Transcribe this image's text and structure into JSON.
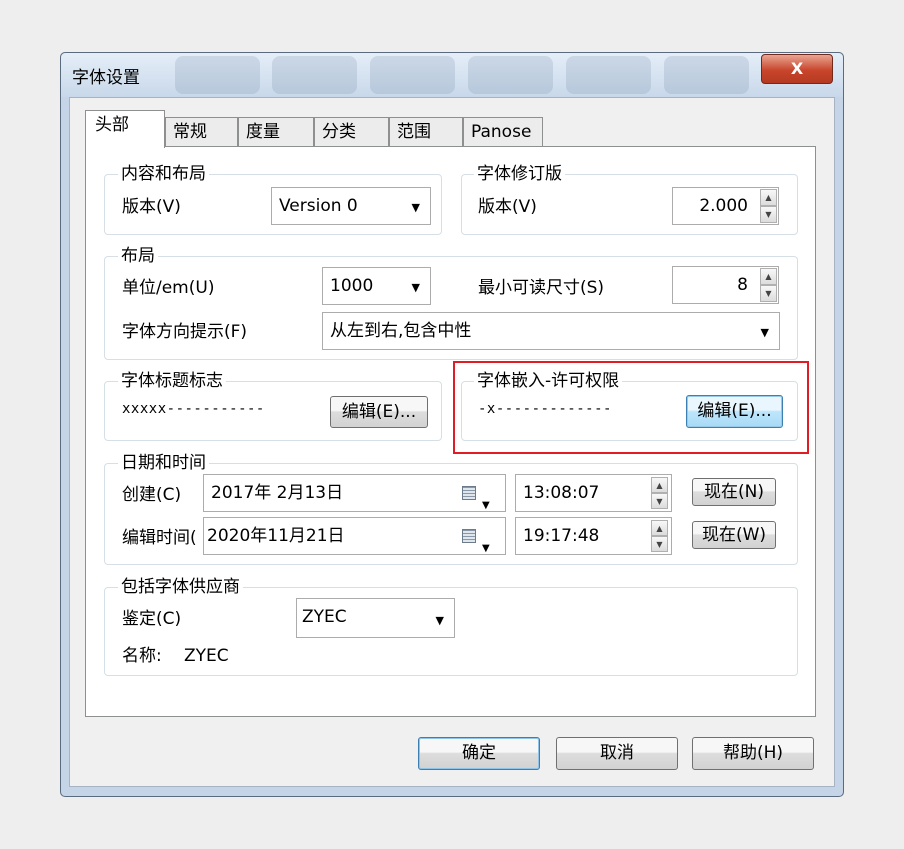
{
  "window": {
    "title": "字体设置",
    "close_label": "X"
  },
  "tabs": [
    {
      "label": "头部",
      "active": true
    },
    {
      "label": "常规"
    },
    {
      "label": "度量"
    },
    {
      "label": "分类"
    },
    {
      "label": "范围"
    },
    {
      "label": "Panose"
    }
  ],
  "content_layout": {
    "legend": "内容和布局",
    "version_label": "版本(V)",
    "version_value": "Version 0"
  },
  "font_revision": {
    "legend": "字体修订版",
    "version_label": "版本(V)",
    "version_value": "2.000"
  },
  "layout": {
    "legend": "布局",
    "units_label": "单位/em(U)",
    "units_value": "1000",
    "min_size_label": "最小可读尺寸(S)",
    "min_size_value": "8",
    "direction_label": "字体方向提示(F)",
    "direction_value": "从左到右,包含中性"
  },
  "style_flags": {
    "legend": "字体标题标志",
    "value": "xxxxx-----------",
    "edit_label": "编辑(E)..."
  },
  "embedding": {
    "legend": "字体嵌入-许可权限",
    "value": "-x-------------",
    "edit_label": "编辑(E)..."
  },
  "datetime": {
    "legend": "日期和时间",
    "created_label": "创建(C)",
    "created_date": "2017年  2月13日",
    "created_time": "13:08:07",
    "now_n_label": "现在(N)",
    "modified_label": "编辑时间(",
    "modified_date": "2020年11月21日",
    "modified_time": "19:17:48",
    "now_w_label": "现在(W)"
  },
  "vendor": {
    "legend": "包括字体供应商",
    "id_label": "鉴定(C)",
    "id_value": "ZYEC",
    "name_label": "名称:",
    "name_value": "ZYEC"
  },
  "footer": {
    "ok_label": "确定",
    "cancel_label": "取消",
    "help_label": "帮助(H)"
  },
  "colors": {
    "highlight_border": "#e01c24",
    "focus_button": "#bee6fd",
    "close_button": "#c8452b"
  }
}
